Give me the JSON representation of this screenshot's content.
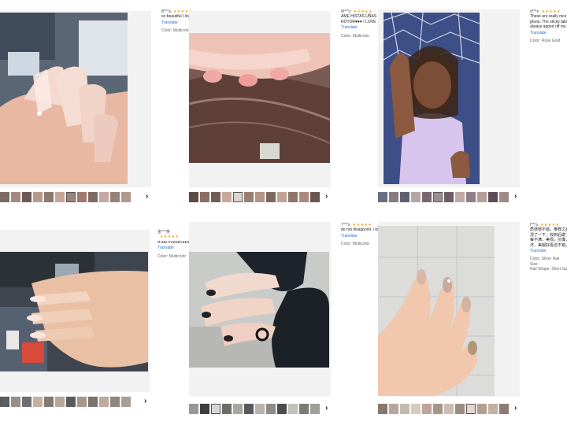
{
  "reviews": [
    {
      "user": "B***a",
      "stars": "★★★★★",
      "text": "so beautiful I love",
      "text2": "",
      "translate": "Translate",
      "color": "Color: Multicolor",
      "thumb_count": 13,
      "selected": 6
    },
    {
      "user": "M***y",
      "stars": "★★★★★",
      "text": "AME HISTAS UÑAS SE",
      "text2": "ROTOR♥♥♥ I LOVE",
      "translate": "Translate",
      "color": "Color: Multicolor",
      "thumb_count": 14,
      "selected": 4
    },
    {
      "user": "d***e",
      "stars": "★★★★★",
      "text": "These are really nice and",
      "text2": "photo. The sticky tabs ar",
      "text3": "always apped off my actu",
      "translate": "Translate",
      "color": "Color: Rose Gold",
      "thumb_count": 13,
      "selected": 5
    },
    {
      "user": "金***英",
      "stars": "★★★★★",
      "text": "สวยมากเลยค่ะผมชอบ ใส่ตัว",
      "text2": "",
      "translate": "Translate",
      "color": "Color: Multicolor",
      "thumb_count": 13,
      "selected": 0
    },
    {
      "user": "T***a",
      "stars": "★★★★★",
      "text": "do not disappoint. i love",
      "text2": "",
      "translate": "Translate",
      "color": "Color: Multicolor",
      "thumb_count": 13,
      "selected": 2
    },
    {
      "user": "f***a",
      "stars": "★★★★★",
      "text": "质感很不错，推荐之后选",
      "text2": "漂了一下，收到后做了已完",
      "text3": "每不满，美观，价廉，已完善",
      "text4": "济，美貌好看还不错。",
      "translate": "Translate",
      "color": "Color: Silver",
      "color_extra": "Nail Size",
      "shape": "Nail Shape: Short Squa",
      "thumb_count": 13,
      "selected": 8
    }
  ],
  "next_arrow": "›",
  "colors": {
    "star": "#f5a623",
    "link": "#2e6fd4"
  }
}
